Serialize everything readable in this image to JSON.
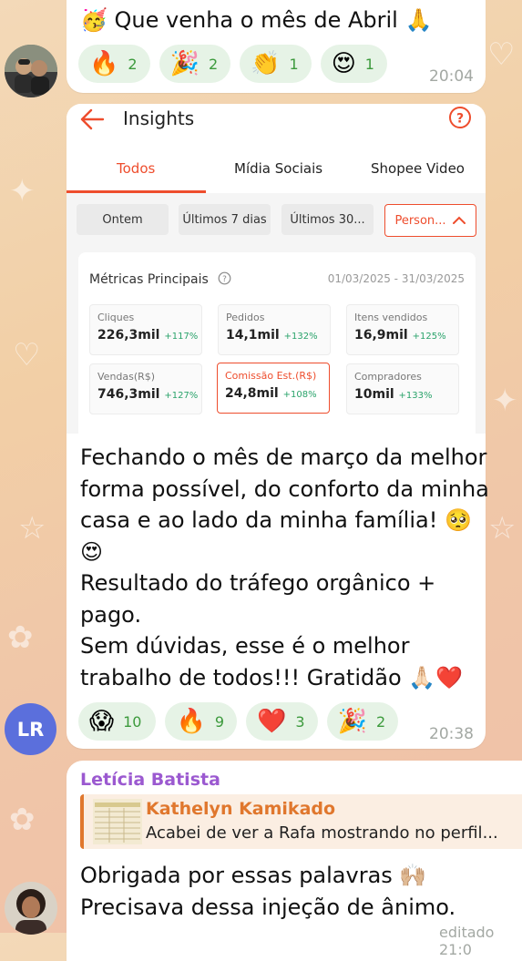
{
  "messages": {
    "m1": {
      "text": "Que venha o mês de Abril",
      "emoji_start": "🥳",
      "emoji_end": "🙏",
      "time": "20:04",
      "reactions": [
        {
          "emoji": "🔥",
          "count": "2"
        },
        {
          "emoji": "🎉",
          "count": "2"
        },
        {
          "emoji": "👏",
          "count": "1"
        },
        {
          "emoji": "😍",
          "count": "1"
        }
      ]
    },
    "m2": {
      "avatar_initials": "LR",
      "avatar_color": "#5b6fdc",
      "lines": [
        "Fechando o mês de março da melhor",
        "forma possível, do conforto da minha",
        "casa e ao lado da minha família! 🥺",
        "😍",
        "Resultado do tráfego orgânico +",
        "pago.",
        "Sem dúvidas, esse é o melhor",
        "trabalho de todos!!! Gratidão 🙏🏻❤️"
      ],
      "time": "20:38",
      "reactions": [
        {
          "emoji": "😱",
          "count": "10"
        },
        {
          "emoji": "🔥",
          "count": "9"
        },
        {
          "emoji": "❤️",
          "count": "3"
        },
        {
          "emoji": "🎉",
          "count": "2"
        }
      ]
    },
    "m3": {
      "sender": "Letícia Batista",
      "reply_name": "Kathelyn Kamikado",
      "reply_text": "Acabei de ver a Rafa mostrando no perfil...",
      "lines": [
        "Obrigada por essas palavras 🙌🏼",
        "Precisava dessa injeção de ânimo."
      ],
      "footer": "editado 21:0"
    }
  },
  "insights": {
    "title": "Insights",
    "tabs": [
      "Todos",
      "Mídia Sociais",
      "Shopee Video"
    ],
    "filters": [
      "Ontem",
      "Últimos 7 dias",
      "Últimos 30...",
      "Person..."
    ],
    "card_title": "Métricas Principais",
    "date_range": "01/03/2025 - 31/03/2025",
    "metrics": [
      {
        "label": "Cliques",
        "value": "226,3mil",
        "delta": "+117%"
      },
      {
        "label": "Pedidos",
        "value": "14,1mil",
        "delta": "+132%"
      },
      {
        "label": "Itens vendidos",
        "value": "16,9mil",
        "delta": "+125%"
      },
      {
        "label": "Vendas(R$)",
        "value": "746,3mil",
        "delta": "+127%"
      },
      {
        "label": "Comissão Est.(R$)",
        "value": "24,8mil",
        "delta": "+108%"
      },
      {
        "label": "Compradores",
        "value": "10mil",
        "delta": "+133%"
      }
    ],
    "accent": "#ee4d2d"
  }
}
